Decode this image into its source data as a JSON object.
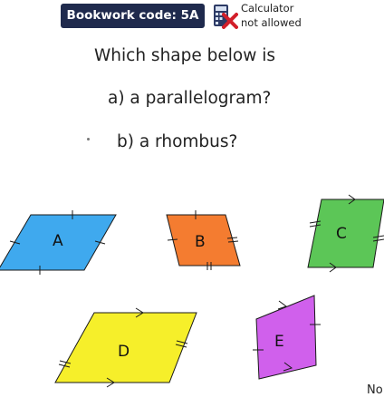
{
  "header": {
    "bookwork_code": "Bookwork code: 5A",
    "calculator_line1": "Calculator",
    "calculator_line2": "not allowed"
  },
  "question": {
    "prompt": "Which shape below is",
    "part_a": "a) a parallelogram?",
    "part_b": "b) a rhombus?"
  },
  "shapes": [
    {
      "label": "A",
      "color": "#3fa9ee"
    },
    {
      "label": "B",
      "color": "#f47c30"
    },
    {
      "label": "C",
      "color": "#5cc657"
    },
    {
      "label": "D",
      "color": "#f6ef2a"
    },
    {
      "label": "E",
      "color": "#d060ec"
    }
  ],
  "footer": {
    "cut_off_text": "No"
  },
  "colors": {
    "badge_bg": "#1f2a4d",
    "calculator_cross": "#d21f2a"
  }
}
